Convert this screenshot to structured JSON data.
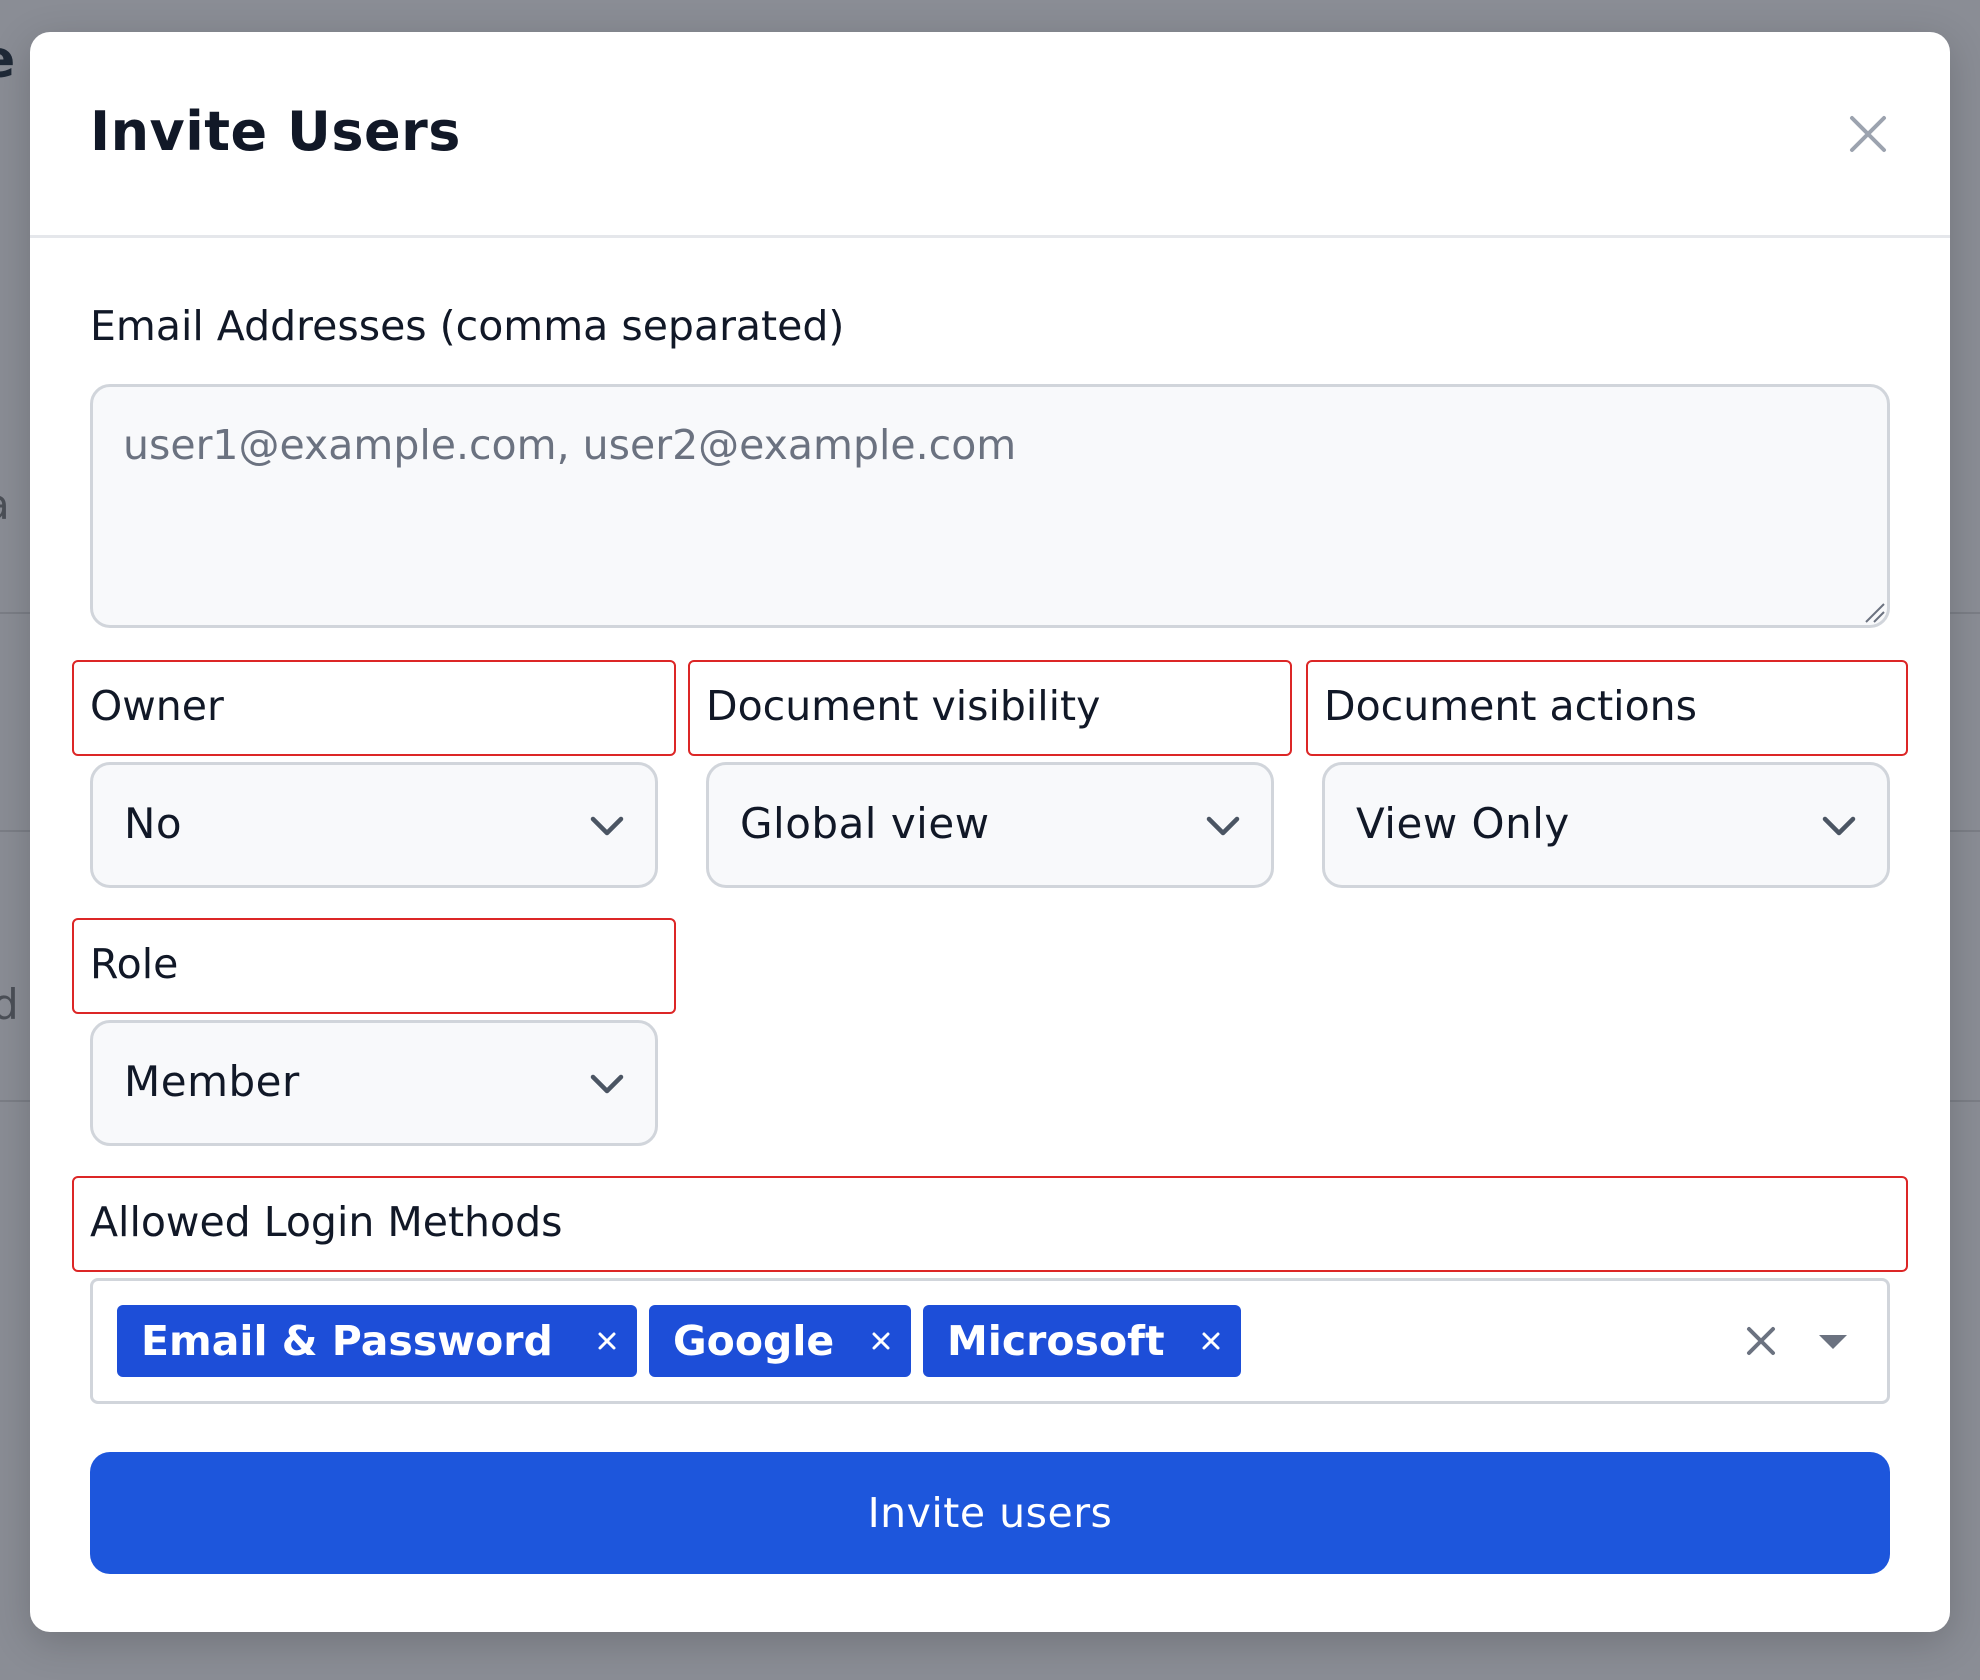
{
  "background": {
    "fragment_top": "e",
    "fragment_mid": "a",
    "fragment_low": "d"
  },
  "modal": {
    "title": "Invite Users",
    "close_icon": "close-icon"
  },
  "email": {
    "label": "Email Addresses (comma separated)",
    "value": "",
    "placeholder": "user1@example.com, user2@example.com"
  },
  "owner": {
    "label": "Owner",
    "value": "No"
  },
  "document_visibility": {
    "label": "Document visibility",
    "value": "Global view"
  },
  "document_actions": {
    "label": "Document actions",
    "value": "View Only"
  },
  "role": {
    "label": "Role",
    "value": "Member"
  },
  "login_methods": {
    "label": "Allowed Login Methods",
    "selected": [
      "Email & Password",
      "Google",
      "Microsoft"
    ]
  },
  "submit": {
    "label": "Invite users"
  },
  "colors": {
    "primary": "#1d56dc",
    "tag": "#1d4ed8",
    "label_outline": "#dc2626",
    "overlay": "#8a8d95"
  }
}
